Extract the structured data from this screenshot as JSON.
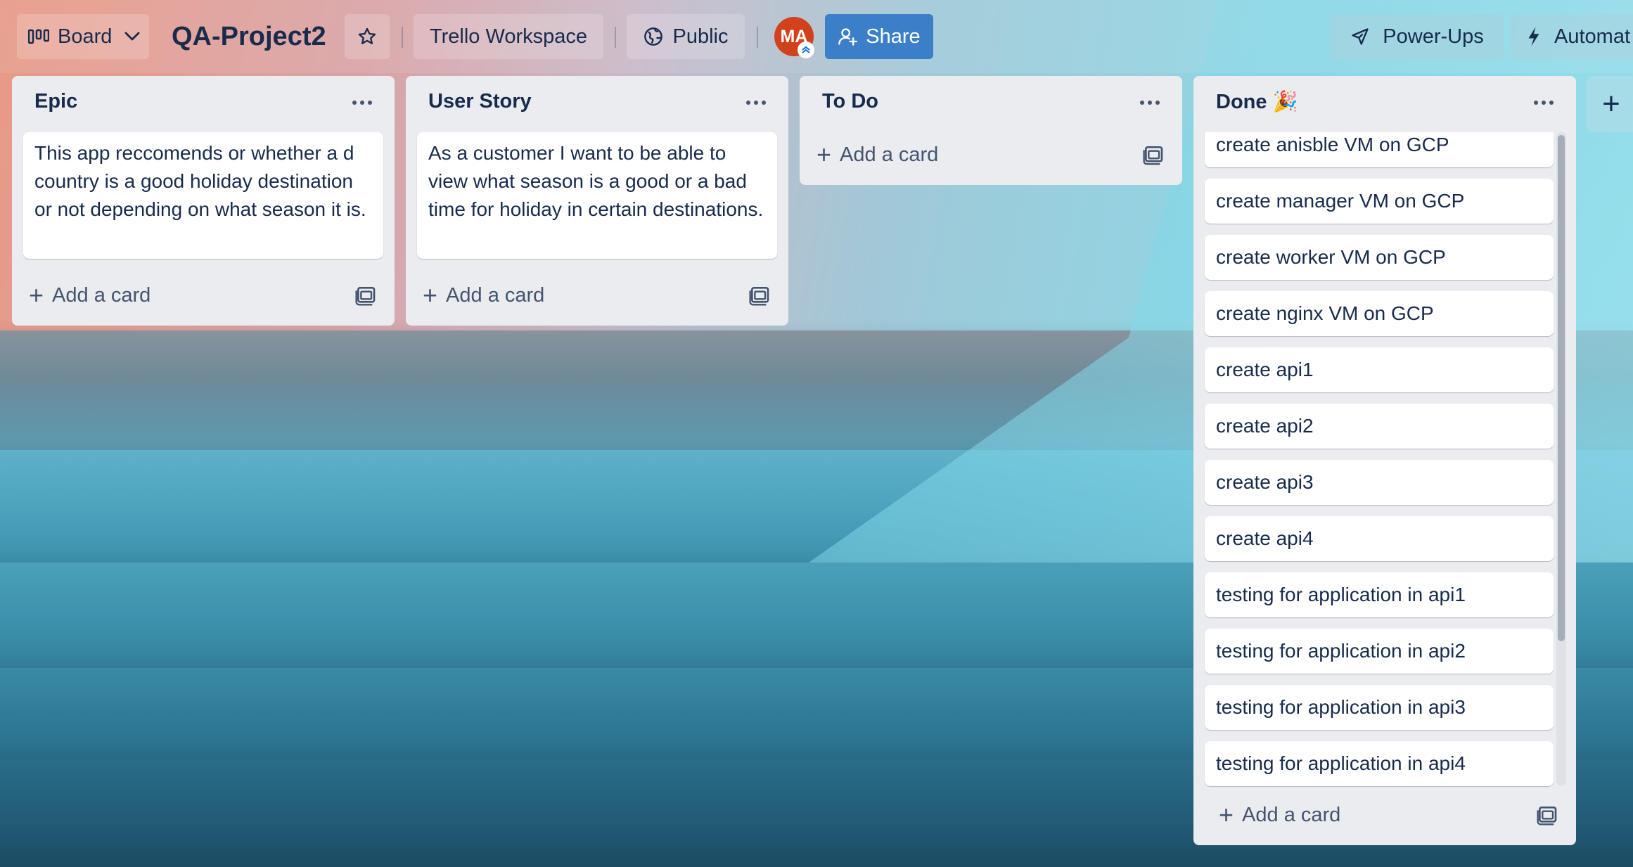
{
  "header": {
    "board_view_label": "Board",
    "board_title": "QA-Project2",
    "workspace_label": "Trello Workspace",
    "visibility_label": "Public",
    "avatar_initials": "MA",
    "share_label": "Share",
    "powerups_label": "Power-Ups",
    "automation_label": "Automat"
  },
  "lists": [
    {
      "title": "Epic",
      "cards": [
        "This app reccomends or whether a d country is a good holiday destination or not depending on what season it is."
      ],
      "add_card_label": "Add a card"
    },
    {
      "title": "User Story",
      "cards": [
        "As a customer I want to be able to view what season is a good or a bad time for holiday in certain destinations."
      ],
      "add_card_label": "Add a card"
    },
    {
      "title": "To Do",
      "cards": [],
      "add_card_label": "Add a card"
    },
    {
      "title": "Done 🎉",
      "cards": [
        "create anisble VM on GCP",
        "create manager VM on GCP",
        "create worker VM on GCP",
        "create nginx VM on GCP",
        "create api1",
        "create api2",
        "create api3",
        "create api4",
        "testing for application in api1",
        "testing for application in api2",
        "testing for application in api3",
        "testing for application in api4"
      ],
      "add_card_label": "Add a card"
    }
  ],
  "add_list_symbol": "+",
  "colors": {
    "share_button": "#3a7fc8",
    "avatar": "#d0421b",
    "list_background": "#ebecf0",
    "text_primary": "#172b4d"
  }
}
